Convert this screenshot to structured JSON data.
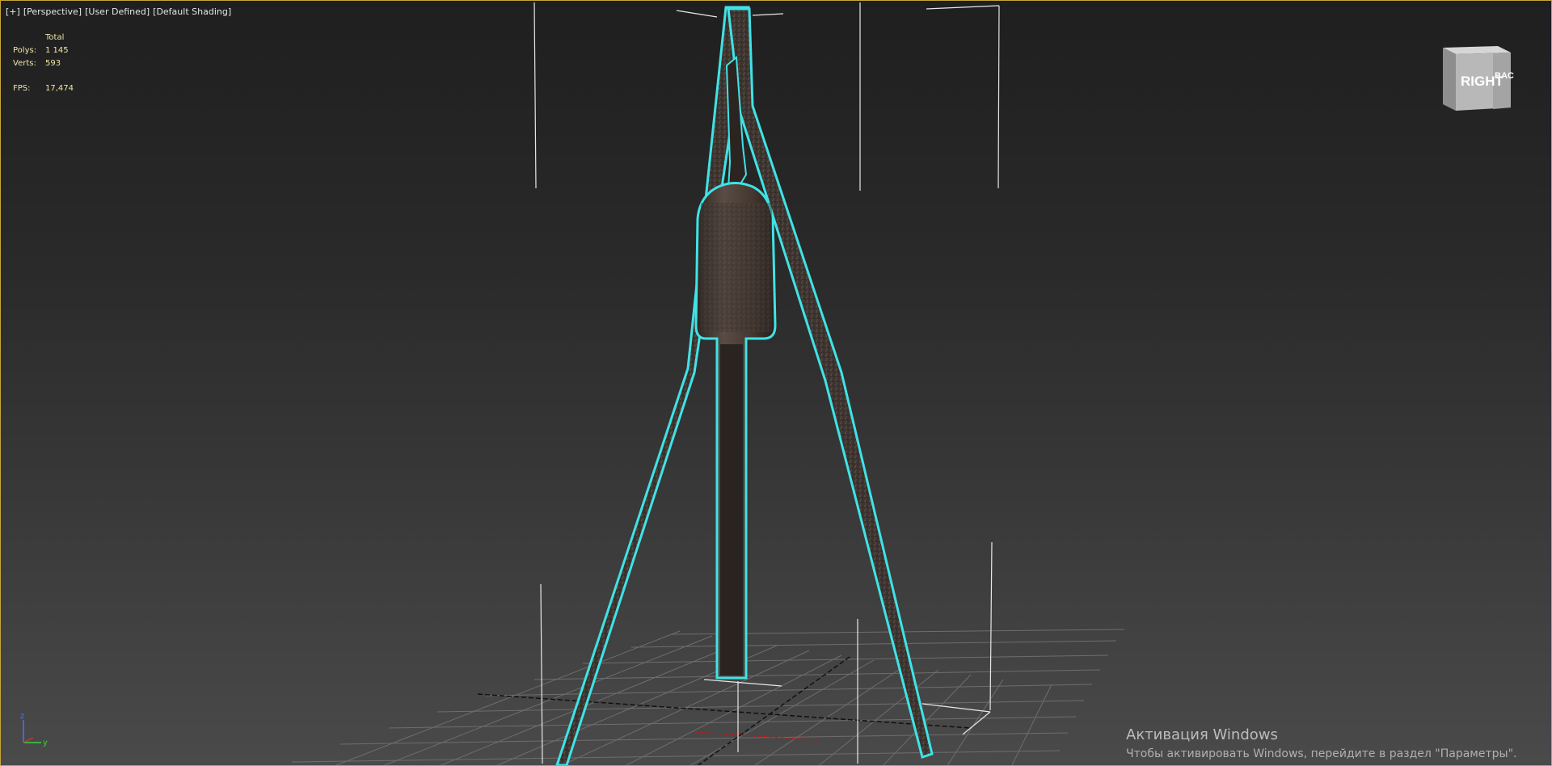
{
  "viewport": {
    "labels": {
      "plus": "[+]",
      "view": "[Perspective]",
      "mode": "[User Defined]",
      "shading": "[Default Shading]"
    },
    "stats": {
      "header": "Total",
      "polys_label": "Polys:",
      "polys_value": "1 145",
      "verts_label": "Verts:",
      "verts_value": "593",
      "fps_label": "FPS:",
      "fps_value": "17,474"
    },
    "viewcube": {
      "front_label": "RIGHT",
      "side_label": "BACK"
    },
    "axis_tripod": {
      "z_label": "z",
      "y_label": "y"
    },
    "selection_color": "#3fe3e6",
    "border_color": "#c7a53a"
  },
  "activation": {
    "title": "Активация Windows",
    "subtitle": "Чтобы активировать Windows, перейдите в раздел \"Параметры\"."
  }
}
